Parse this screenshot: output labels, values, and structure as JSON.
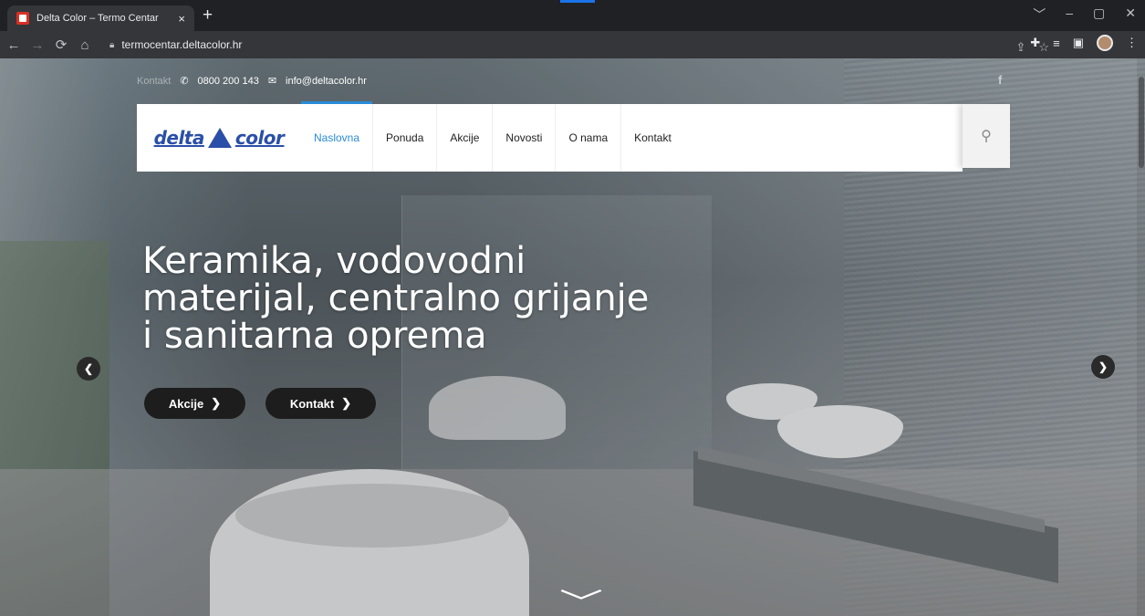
{
  "browser": {
    "tab_title": "Delta Color – Termo Centar",
    "tab_close": "×",
    "new_tab": "+",
    "url": "termocentar.deltacolor.hr",
    "controls": {
      "minimize": "–",
      "maximize": "▢",
      "close": "✕",
      "chevron": "﹀"
    }
  },
  "site": {
    "topbar": {
      "contact_label": "Kontakt",
      "phone": "0800 200 143",
      "email": "info@deltacolor.hr"
    },
    "logo": {
      "left": "delta",
      "right": "color"
    },
    "nav": {
      "items": [
        "Naslovna",
        "Ponuda",
        "Akcije",
        "Novosti",
        "O nama",
        "Kontakt"
      ],
      "active": "Naslovna"
    },
    "hero": {
      "title": "Keramika, vodovodni materijal, centralno grijanje i sanitarna oprema",
      "buttons": [
        "Akcije",
        "Kontakt"
      ]
    }
  },
  "icons": {
    "back": "arrow-left-icon",
    "forward": "arrow-right-icon",
    "reload": "reload-icon",
    "home": "home-icon",
    "lock": "lock-icon",
    "share": "share-icon",
    "star": "star-icon",
    "extensions": "puzzle-icon",
    "reading_list": "reading-list-icon",
    "side_panel": "side-panel-icon",
    "profile": "avatar-icon",
    "menu": "kebab-menu-icon",
    "phone": "phone-icon",
    "mail": "mail-icon",
    "facebook": "facebook-icon",
    "search": "search-icon",
    "slider_prev": "chevron-left-icon",
    "slider_next": "chevron-right-icon",
    "scroll_down": "chevron-down-icon"
  },
  "colors": {
    "accent": "#2a8bd8",
    "logo_blue": "#2a4fa8",
    "button_dark": "#1d1d1d"
  }
}
